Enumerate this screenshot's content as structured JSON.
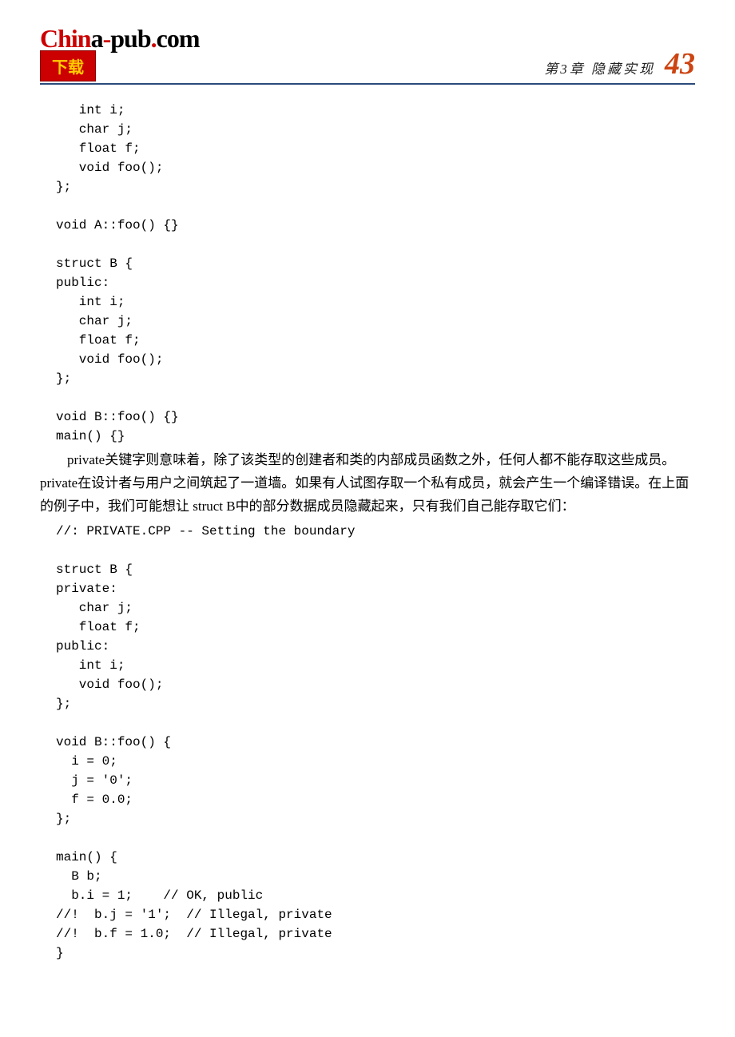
{
  "header": {
    "logo_red1": "Chin",
    "logo_black1": "a",
    "logo_red2": "-",
    "logo_black2": "pub",
    "logo_red3": ".",
    "logo_black3": "com",
    "download": "下载",
    "chapter": "第3章 隐藏实现",
    "page_number": "43"
  },
  "code1": "   int i;\n   char j;\n   float f;\n   void foo();\n};\n\nvoid A::foo() {}\n\nstruct B {\npublic:\n   int i;\n   char j;\n   float f;\n   void foo();\n};\n\nvoid B::foo() {}\nmain() {}",
  "para1": "private关键字则意味着，除了该类型的创建者和类的内部成员函数之外，任何人都不能存取这些成员。private在设计者与用户之间筑起了一道墙。如果有人试图存取一个私有成员，就会产生一个编译错误。在上面的例子中，我们可能想让 struct B中的部分数据成员隐藏起来，只有我们自己能存取它们：",
  "code2": "//: PRIVATE.CPP -- Setting the boundary\n\nstruct B {\nprivate:\n   char j;\n   float f;\npublic:\n   int i;\n   void foo();\n};\n\nvoid B::foo() {\n  i = 0;\n  j = '0';\n  f = 0.0;\n};\n\nmain() {\n  B b;\n  b.i = 1;    // OK, public\n//!  b.j = '1';  // Illegal, private\n//!  b.f = 1.0;  // Illegal, private\n}"
}
